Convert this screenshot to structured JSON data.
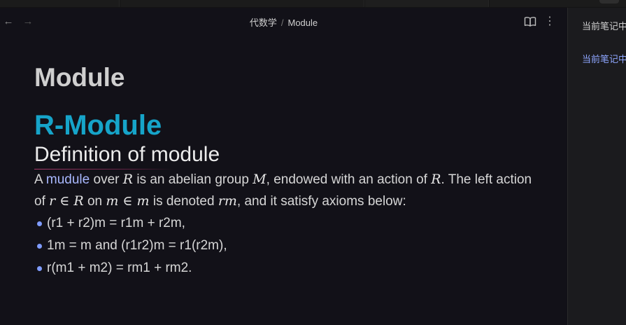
{
  "breadcrumb": {
    "parent": "代数学",
    "separator": "/",
    "current": "Module"
  },
  "icons": {
    "back": "arrow-left-icon",
    "forward": "arrow-right-icon",
    "view": "book-open-icon",
    "more": "more-vertical-icon"
  },
  "colors": {
    "heading_accent": "#16a4c9",
    "link": "#a9b8ff",
    "bullet": "#7f9cff",
    "background": "#121118"
  },
  "note": {
    "title": "Module",
    "h2": "R-Module",
    "h3": "Definition of module",
    "para": {
      "t1": "A ",
      "kw": "mudule",
      "t2": " over ",
      "m_R1": "R",
      "t3": " is an abelian group ",
      "m_M": "M",
      "t4": ", endowed with an action of ",
      "m_R2": "R",
      "t5": ". The left action of ",
      "m_rinR": "r ∈ R",
      "t6": " on ",
      "m_minm": "m ∈ m",
      "t7": " is denoted ",
      "m_rm": "rm",
      "t8": ", and it satisfy axioms below:"
    },
    "axioms": [
      "(r1 + r2)m = r1m + r2m,",
      "1m = m and (r1r2)m = r1(r2m),",
      "r(m1 + m2) = rm1 + rm2."
    ]
  },
  "right_panel": {
    "title": "当前笔记中",
    "link": "当前笔记中"
  }
}
